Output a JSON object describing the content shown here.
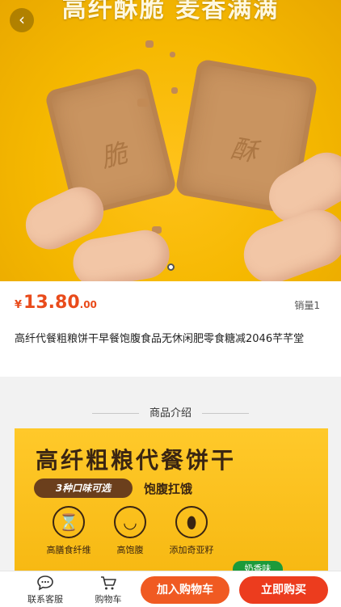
{
  "hero": {
    "banner_text": "高纤酥脆 麦香满满",
    "biscuit_left_text": "脆",
    "biscuit_right_text": "酥",
    "carousel_dot": "●"
  },
  "nav": {
    "back_icon": "chevron-left-icon",
    "back_glyph": "‹"
  },
  "product": {
    "currency": "¥",
    "price_integer": "13.80",
    "price_decimal": ".00",
    "sales": "销量1",
    "title": "高纤代餐粗粮饼干早餐饱腹食品无休闲肥零食糖减2046芊芊堂"
  },
  "intro": {
    "heading": "商品介绍",
    "poster_title": "高纤粗粮代餐饼干",
    "poster_pill": "3种口味可选",
    "poster_sub": "饱腹扛饿",
    "features": [
      {
        "icon": "hourglass-icon",
        "glyph": "⌛",
        "label": "高膳食纤维"
      },
      {
        "icon": "belly-icon",
        "glyph": "◡",
        "label": "高饱腹"
      },
      {
        "icon": "seed-icon",
        "glyph": "⬮",
        "label": "添加奇亚籽"
      }
    ],
    "flavor_badge": "奶香味"
  },
  "bottom": {
    "service_label": "联系客服",
    "cart_label": "购物车",
    "add_to_cart": "加入购物车",
    "buy_now": "立即购买"
  },
  "colors": {
    "accent": "#ec3c1e",
    "price": "#e94b1b",
    "poster": "#ffc92a"
  }
}
